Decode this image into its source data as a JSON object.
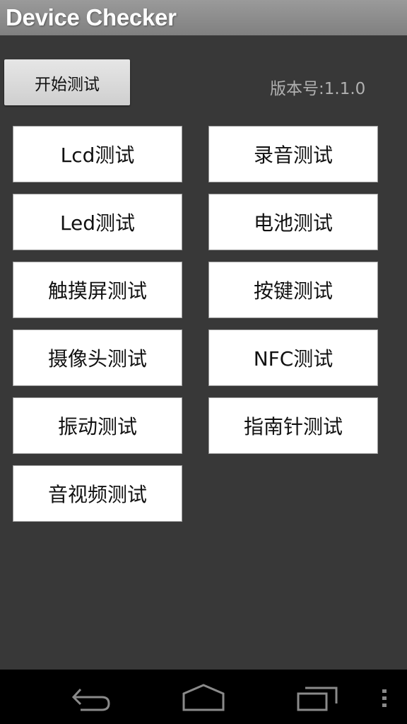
{
  "app": {
    "title": "Device Checker"
  },
  "toolbar": {
    "start_label": "开始测试",
    "version_label": "版本号:1.1.0"
  },
  "tests": [
    {
      "label": "Lcd测试"
    },
    {
      "label": "录音测试"
    },
    {
      "label": "Led测试"
    },
    {
      "label": "电池测试"
    },
    {
      "label": "触摸屏测试"
    },
    {
      "label": "按键测试"
    },
    {
      "label": "摄像头测试"
    },
    {
      "label": "NFC测试"
    },
    {
      "label": "振动测试"
    },
    {
      "label": "指南针测试"
    },
    {
      "label": "音视频测试"
    }
  ],
  "navbar": {
    "icons": [
      "back-icon",
      "home-icon",
      "recent-apps-icon",
      "overflow-menu-icon"
    ]
  },
  "colors": {
    "background": "#383838",
    "titlebar": "#8c8c8c",
    "button": "#ffffff",
    "navbar": "#000000",
    "nav_icon": "#8a8a8a"
  }
}
